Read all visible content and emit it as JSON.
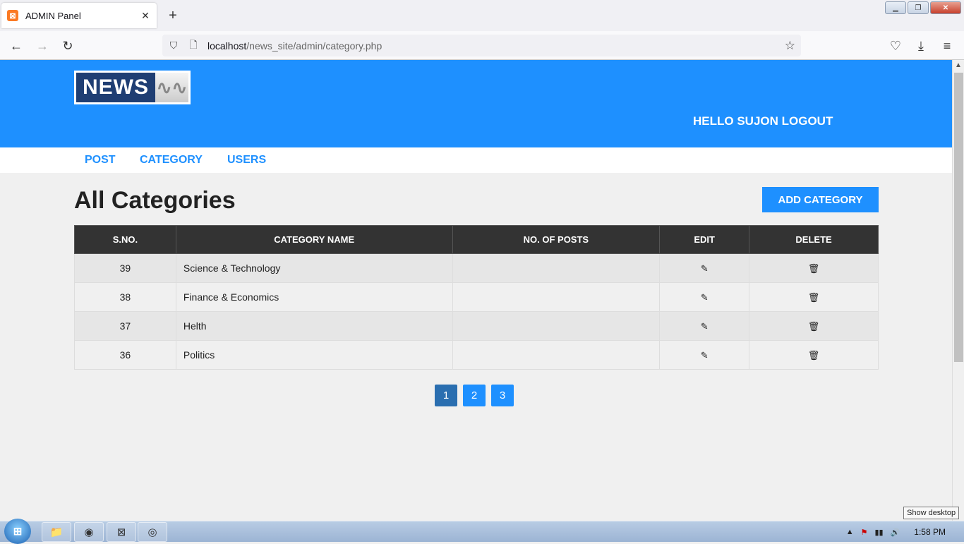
{
  "browser": {
    "tab_title": "ADMIN Panel",
    "tab_close": "✕",
    "new_tab": "+",
    "favicon_glyph": "⊠",
    "url_host": "localhost",
    "url_path": "/news_site/admin/category.php",
    "back_icon": "←",
    "forward_icon": "→",
    "reload_icon": "↻",
    "shield_icon": "⛉",
    "page_icon": "🗋",
    "star_icon": "☆",
    "pocket_icon": "♡",
    "download_icon": "⤓",
    "menu_icon": "≡",
    "window_buttons": {
      "minimize": "▁",
      "restore": "❐",
      "close": "✕"
    }
  },
  "header": {
    "logo_text": "NEWS",
    "logo_mark": "∿∿",
    "greeting": "HELLO SUJON LOGOUT"
  },
  "menu": {
    "items": [
      "POST",
      "CATEGORY",
      "USERS"
    ]
  },
  "main": {
    "title": "All Categories",
    "add_button": "ADD CATEGORY",
    "table": {
      "headers": [
        "S.NO.",
        "CATEGORY NAME",
        "NO. OF POSTS",
        "EDIT",
        "DELETE"
      ],
      "rows": [
        {
          "sno": "39",
          "name": "Science & Technology",
          "posts": ""
        },
        {
          "sno": "38",
          "name": "Finance & Economics",
          "posts": ""
        },
        {
          "sno": "37",
          "name": "Helth",
          "posts": ""
        },
        {
          "sno": "36",
          "name": "Politics",
          "posts": ""
        }
      ],
      "edit_icon": "✎",
      "delete_icon": "🗑"
    },
    "pagination": [
      "1",
      "2",
      "3"
    ],
    "active_page": "1"
  },
  "taskbar": {
    "start_glyph": "⊞",
    "apps": [
      "📁",
      "◉",
      "⊠",
      "◎"
    ],
    "clock": "1:58 PM",
    "show_desktop_tooltip": "Show desktop",
    "tray_icons": [
      "▲",
      "⚑",
      "▮▮",
      "🔊"
    ]
  },
  "colors": {
    "brand_blue": "#1e90ff",
    "header_dark": "#333333",
    "active_page": "#2a6eb0"
  }
}
